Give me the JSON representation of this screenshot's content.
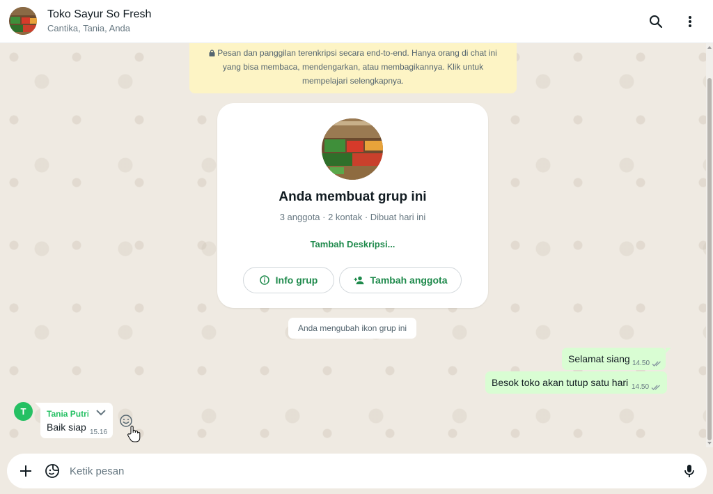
{
  "header": {
    "title": "Toko Sayur So Fresh",
    "subtitle": "Cantika, Tania, Anda"
  },
  "encryption_notice": "Pesan dan panggilan terenkripsi secara end-to-end. Hanya orang di chat ini yang bisa membaca, mendengarkan, atau membagikannya. Klik untuk mempelajari selengkapnya.",
  "group_card": {
    "title": "Anda membuat grup ini",
    "meta": "3 anggota · 2 kontak · Dibuat hari ini",
    "add_description": "Tambah Deskripsi...",
    "info_button": "Info grup",
    "add_member_button": "Tambah anggota"
  },
  "system_message": "Anda mengubah ikon grup ini",
  "outgoing": [
    {
      "text": "Selamat siang",
      "time": "14.50"
    },
    {
      "text": "Besok toko akan tutup satu hari",
      "time": "14.50"
    }
  ],
  "incoming": {
    "avatar_letter": "T",
    "sender": "Tania Putri",
    "text": "Baik siap",
    "time": "15.16"
  },
  "composer": {
    "placeholder": "Ketik pesan"
  },
  "colors": {
    "accent": "#1f8a4c",
    "outgoing_bubble": "#d9fdd3",
    "notice_bg": "#fdf4c5",
    "chat_bg": "#efeae2"
  },
  "icons": [
    "search-icon",
    "menu-icon",
    "lock-icon",
    "info-icon",
    "add-person-icon",
    "chevron-down-icon",
    "emoji-icon",
    "plus-icon",
    "sticker-icon",
    "microphone-icon",
    "double-check-icon"
  ]
}
